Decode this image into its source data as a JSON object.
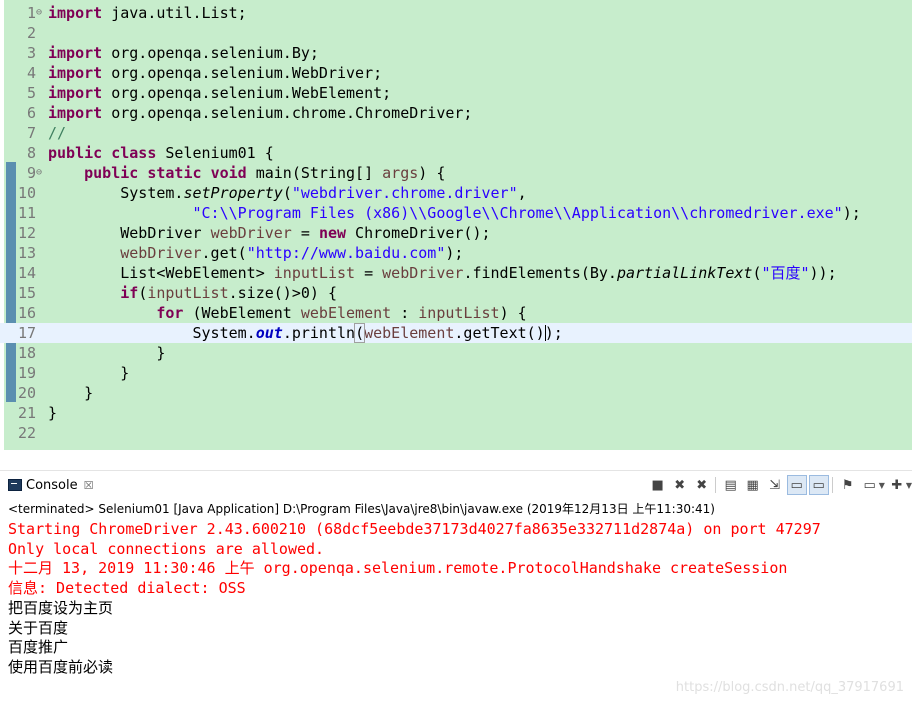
{
  "editor": {
    "lines": [
      {
        "n": "1",
        "fold": "⊖",
        "segs": [
          {
            "t": "import",
            "c": "kw"
          },
          {
            "t": " java.util.List;",
            "c": ""
          }
        ]
      },
      {
        "n": "2",
        "segs": []
      },
      {
        "n": "3",
        "segs": [
          {
            "t": "import",
            "c": "kw"
          },
          {
            "t": " org.openqa.selenium.By;",
            "c": ""
          }
        ]
      },
      {
        "n": "4",
        "segs": [
          {
            "t": "import",
            "c": "kw"
          },
          {
            "t": " org.openqa.selenium.WebDriver;",
            "c": ""
          }
        ]
      },
      {
        "n": "5",
        "segs": [
          {
            "t": "import",
            "c": "kw"
          },
          {
            "t": " org.openqa.selenium.WebElement;",
            "c": ""
          }
        ]
      },
      {
        "n": "6",
        "segs": [
          {
            "t": "import",
            "c": "kw"
          },
          {
            "t": " org.openqa.selenium.chrome.ChromeDriver;",
            "c": ""
          }
        ]
      },
      {
        "n": "7",
        "segs": [
          {
            "t": "//",
            "c": "cmt"
          }
        ]
      },
      {
        "n": "8",
        "segs": [
          {
            "t": "public",
            "c": "kw"
          },
          {
            "t": " ",
            "c": ""
          },
          {
            "t": "class",
            "c": "kw"
          },
          {
            "t": " Selenium01 {",
            "c": ""
          }
        ]
      },
      {
        "n": "9",
        "fold": "⊖",
        "segs": [
          {
            "t": "    ",
            "c": ""
          },
          {
            "t": "public",
            "c": "kw"
          },
          {
            "t": " ",
            "c": ""
          },
          {
            "t": "static",
            "c": "kw"
          },
          {
            "t": " ",
            "c": ""
          },
          {
            "t": "void",
            "c": "kw"
          },
          {
            "t": " main(String[] ",
            "c": ""
          },
          {
            "t": "args",
            "c": "var"
          },
          {
            "t": ") {",
            "c": ""
          }
        ]
      },
      {
        "n": "10",
        "segs": [
          {
            "t": "        System.",
            "c": ""
          },
          {
            "t": "setProperty",
            "c": "italic"
          },
          {
            "t": "(",
            "c": ""
          },
          {
            "t": "\"webdriver.chrome.driver\"",
            "c": "str"
          },
          {
            "t": ",",
            "c": ""
          }
        ]
      },
      {
        "n": "11",
        "segs": [
          {
            "t": "            ",
            "c": ""
          },
          {
            "t": "    \"C:\\\\Program Files (x86)\\\\Google\\\\Chrome\\\\Application\\\\chromedriver.exe\"",
            "c": "str"
          },
          {
            "t": ");",
            "c": ""
          }
        ]
      },
      {
        "n": "12",
        "segs": [
          {
            "t": "        WebDriver ",
            "c": ""
          },
          {
            "t": "webDriver",
            "c": "var"
          },
          {
            "t": " = ",
            "c": ""
          },
          {
            "t": "new",
            "c": "kw"
          },
          {
            "t": " ChromeDriver();",
            "c": ""
          }
        ]
      },
      {
        "n": "13",
        "segs": [
          {
            "t": "        ",
            "c": ""
          },
          {
            "t": "webDriver",
            "c": "var"
          },
          {
            "t": ".get(",
            "c": ""
          },
          {
            "t": "\"http://www.baidu.com\"",
            "c": "str"
          },
          {
            "t": ");",
            "c": ""
          }
        ]
      },
      {
        "n": "14",
        "segs": [
          {
            "t": "        List<WebElement> ",
            "c": ""
          },
          {
            "t": "inputList",
            "c": "var"
          },
          {
            "t": " = ",
            "c": ""
          },
          {
            "t": "webDriver",
            "c": "var"
          },
          {
            "t": ".findElements(By.",
            "c": ""
          },
          {
            "t": "partialLinkText",
            "c": "italic"
          },
          {
            "t": "(",
            "c": ""
          },
          {
            "t": "\"百度\"",
            "c": "str"
          },
          {
            "t": "));",
            "c": ""
          }
        ]
      },
      {
        "n": "15",
        "segs": [
          {
            "t": "        ",
            "c": ""
          },
          {
            "t": "if",
            "c": "kw"
          },
          {
            "t": "(",
            "c": ""
          },
          {
            "t": "inputList",
            "c": "var"
          },
          {
            "t": ".size()>0) {",
            "c": ""
          }
        ]
      },
      {
        "n": "16",
        "segs": [
          {
            "t": "            ",
            "c": ""
          },
          {
            "t": "for",
            "c": "kw"
          },
          {
            "t": " (WebElement ",
            "c": ""
          },
          {
            "t": "webElement",
            "c": "var"
          },
          {
            "t": " : ",
            "c": ""
          },
          {
            "t": "inputList",
            "c": "var"
          },
          {
            "t": ") {",
            "c": ""
          }
        ]
      },
      {
        "n": "17",
        "current": true,
        "segs": [
          {
            "t": "                System.",
            "c": ""
          },
          {
            "t": "out",
            "c": "fld"
          },
          {
            "t": ".println",
            "c": ""
          },
          {
            "t": "(",
            "c": "box"
          },
          {
            "t": "webElement",
            "c": "var"
          },
          {
            "t": ".getText()",
            "c": ""
          },
          {
            "t": "|",
            "c": "caret"
          },
          {
            "t": ");",
            "c": ""
          }
        ]
      },
      {
        "n": "18",
        "segs": [
          {
            "t": "            }",
            "c": ""
          }
        ]
      },
      {
        "n": "19",
        "segs": [
          {
            "t": "        }",
            "c": ""
          }
        ]
      },
      {
        "n": "20",
        "segs": [
          {
            "t": "    }",
            "c": ""
          }
        ]
      },
      {
        "n": "21",
        "segs": [
          {
            "t": "}",
            "c": ""
          }
        ]
      },
      {
        "n": "22",
        "segs": []
      }
    ]
  },
  "console": {
    "tab_label": "Console",
    "tab_close": "☒",
    "terminated_text": "<terminated> Selenium01 [Java Application] D:\\Program Files\\Java\\jre8\\bin\\javaw.exe (2019年12月13日 上午11:30:41)",
    "output": [
      {
        "t": "Starting ChromeDriver 2.43.600210 (68dcf5eebde37173d4027fa8635e332711d2874a) on port 47297",
        "kind": "err"
      },
      {
        "t": "Only local connections are allowed.",
        "kind": "err"
      },
      {
        "t": "十二月 13, 2019 11:30:46 上午 org.openqa.selenium.remote.ProtocolHandshake createSession",
        "kind": "err"
      },
      {
        "t": "信息: Detected dialect: OSS",
        "kind": "err"
      },
      {
        "t": "把百度设为主页",
        "kind": "std"
      },
      {
        "t": "关于百度",
        "kind": "std"
      },
      {
        "t": "百度推广",
        "kind": "std"
      },
      {
        "t": "使用百度前必读",
        "kind": "std"
      }
    ],
    "toolbar": [
      {
        "name": "terminate-icon",
        "glyph": "■"
      },
      {
        "name": "remove-launch-icon",
        "glyph": "✖"
      },
      {
        "name": "remove-all-terminated-icon",
        "glyph": "✖"
      },
      {
        "name": "sep"
      },
      {
        "name": "clear-console-icon",
        "glyph": "▤"
      },
      {
        "name": "scroll-lock-icon",
        "glyph": "▦"
      },
      {
        "name": "word-wrap-icon",
        "glyph": "⇲"
      },
      {
        "name": "show-on-stdout-icon",
        "glyph": "▭",
        "pressed": true
      },
      {
        "name": "show-on-stderr-icon",
        "glyph": "▭",
        "pressed": true
      },
      {
        "name": "sep"
      },
      {
        "name": "pin-console-icon",
        "glyph": "⚑"
      },
      {
        "name": "display-selected-console-icon",
        "glyph": "▭",
        "dropdown": true
      },
      {
        "name": "open-console-icon",
        "glyph": "✚",
        "dropdown": true
      }
    ]
  },
  "watermark": "https://blog.csdn.net/qq_37917691"
}
